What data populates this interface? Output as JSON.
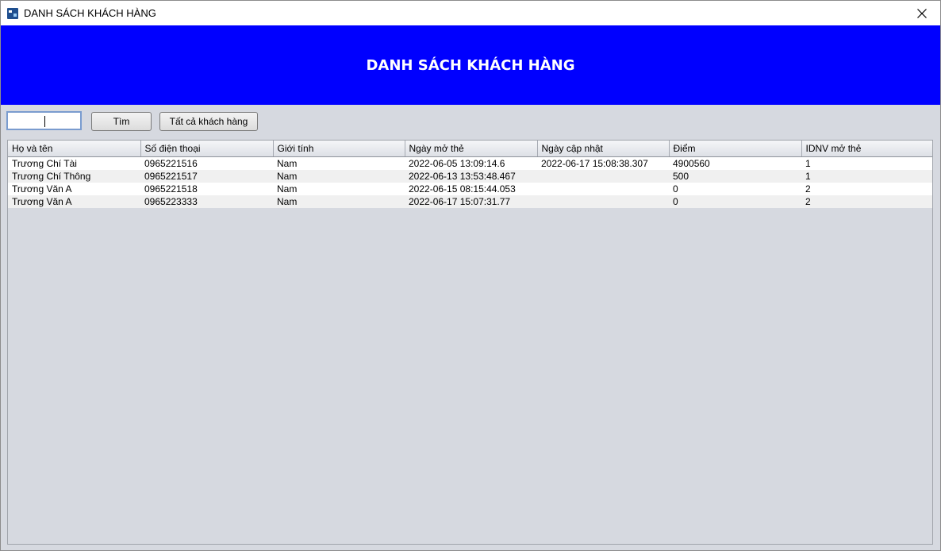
{
  "window": {
    "title": "DANH SÁCH KHÁCH HÀNG",
    "app_icon": "java-app-icon",
    "close_icon": "close-icon"
  },
  "banner": {
    "title": "DANH SÁCH KHÁCH HÀNG",
    "background": "#0000ff",
    "text_color": "#ffffff"
  },
  "toolbar": {
    "search_value": "",
    "find_label": "Tìm",
    "show_all_label": "Tất cả khách hàng"
  },
  "table": {
    "columns": [
      "Họ và tên",
      "Số điện thoại",
      "Giới tính",
      "Ngày mở thẻ",
      "Ngày cập nhật",
      "Điểm",
      "IDNV mở thẻ"
    ],
    "rows": [
      [
        "Trương Chí Tài",
        "0965221516",
        "Nam",
        "2022-06-05 13:09:14.6",
        "2022-06-17 15:08:38.307",
        "4900560",
        "1"
      ],
      [
        "Trương Chí Thông",
        "0965221517",
        "Nam",
        "2022-06-13 13:53:48.467",
        "",
        "500",
        "1"
      ],
      [
        "Trương Văn A",
        "0965221518",
        "Nam",
        "2022-06-15 08:15:44.053",
        "",
        "0",
        "2"
      ],
      [
        "Trương Văn A",
        "0965223333",
        "Nam",
        "2022-06-17 15:07:31.77",
        "",
        "0",
        "2"
      ]
    ]
  }
}
